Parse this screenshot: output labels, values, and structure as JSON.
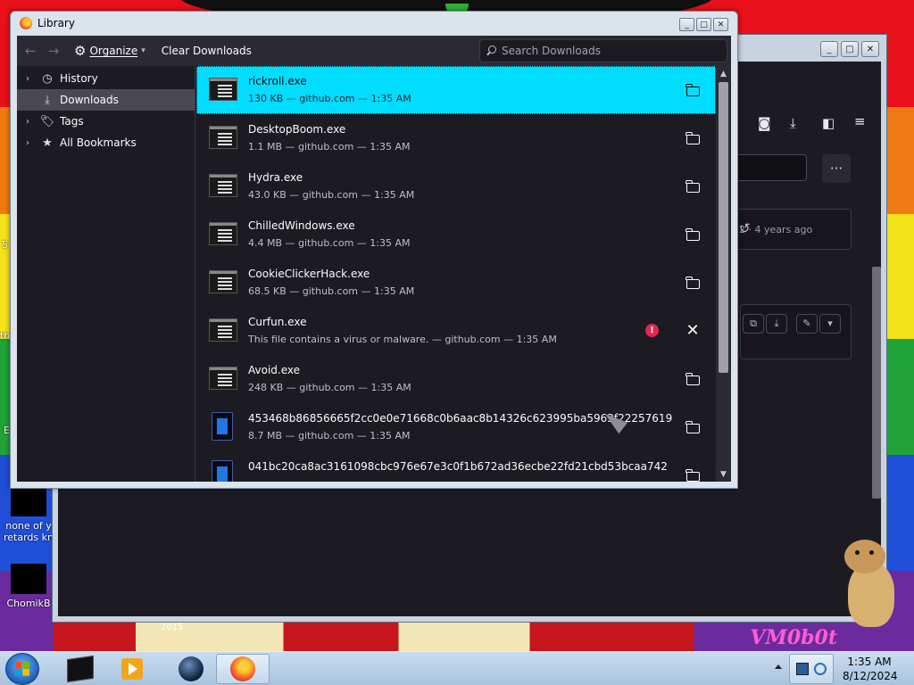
{
  "library": {
    "title": "Library",
    "caption_min": "_",
    "caption_max": "□",
    "caption_close": "✕",
    "toolbar": {
      "back": "←",
      "forward": "→",
      "organize_label": "Organize",
      "organize_caret": "▾",
      "clear_label": "Clear Downloads",
      "search_placeholder": "Search Downloads"
    },
    "sidebar": {
      "items": [
        {
          "label": "History",
          "icon": "clock-icon",
          "twisty": "›"
        },
        {
          "label": "Downloads",
          "icon": "download-icon",
          "twisty": ""
        },
        {
          "label": "Tags",
          "icon": "tag-icon",
          "twisty": "›"
        },
        {
          "label": "All Bookmarks",
          "icon": "star-icon",
          "twisty": "›"
        }
      ]
    },
    "downloads": [
      {
        "name": "rickroll.exe",
        "meta": "130 KB — github.com — 1:35 AM",
        "icon": "exe-icon",
        "action": "folder-icon",
        "selected": true
      },
      {
        "name": "DesktopBoom.exe",
        "meta": "1.1 MB — github.com — 1:35 AM",
        "icon": "exe-icon",
        "action": "folder-icon"
      },
      {
        "name": "Hydra.exe",
        "meta": "43.0 KB — github.com — 1:35 AM",
        "icon": "exe-icon",
        "action": "folder-icon"
      },
      {
        "name": "ChilledWindows.exe",
        "meta": "4.4 MB — github.com — 1:35 AM",
        "icon": "exe-icon",
        "action": "folder-icon"
      },
      {
        "name": "CookieClickerHack.exe",
        "meta": "68.5 KB — github.com — 1:35 AM",
        "icon": "exe-icon",
        "action": "folder-icon"
      },
      {
        "name": "Curfun.exe",
        "meta": "This file contains a virus or malware. — github.com — 1:35 AM",
        "icon": "exe-icon",
        "action": "close-icon",
        "warning": "!"
      },
      {
        "name": "Avoid.exe",
        "meta": "248 KB — github.com — 1:35 AM",
        "icon": "exe-icon",
        "action": "folder-icon"
      },
      {
        "name": "453468b86856665f2cc0e0e71668c0b6aac8b14326c623995ba5963f22257619",
        "meta": "8.7 MB — github.com — 1:35 AM",
        "icon": "blue-file-icon",
        "action": "folder-icon"
      },
      {
        "name": "041bc20ca8ac3161098cbc976e67e3c0f1b672ad36ecbe22fd21cbd53bcaa742",
        "meta": "",
        "icon": "blue-file-icon",
        "action": "folder-icon"
      }
    ]
  },
  "background_window": {
    "timestamp_text": "2 · 4 years ago",
    "more_label": "···"
  },
  "desktop": {
    "icon_label_1": "none of y retards kn",
    "icon_label_2": "ChomikB",
    "frag_1": "5",
    "frag_2": "th",
    "frag_3": "E",
    "art_text": "VM0b0t",
    "art_year": "2015"
  },
  "taskbar": {
    "time": "1:35 AM",
    "date": "8/12/2024"
  },
  "colors": {
    "selection": "#00ddff",
    "warning": "#e22850",
    "panel": "#1c1b22",
    "toolbar": "#2b2a33"
  }
}
